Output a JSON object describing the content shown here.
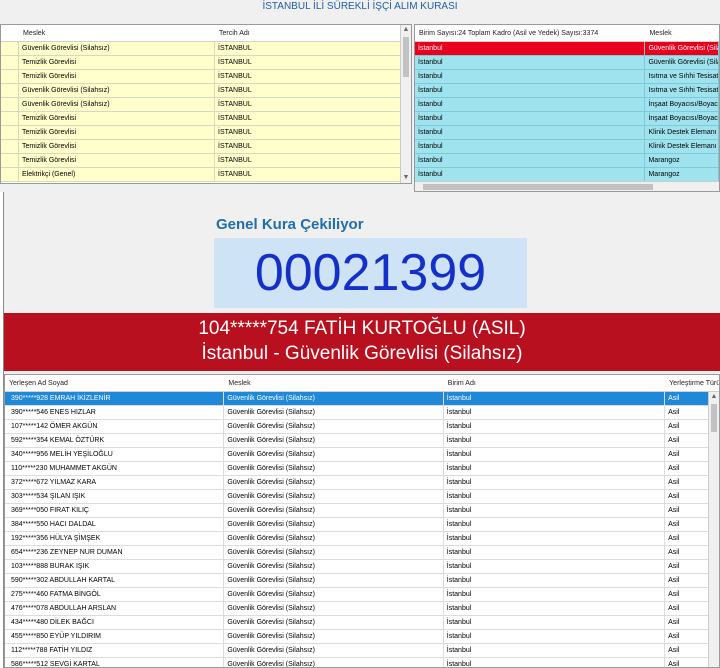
{
  "window": {
    "title": "İSTANBUL İLİ SÜREKLİ İŞÇİ ALIM KURASI"
  },
  "top_left": {
    "columns": [
      "Meslek",
      "Tercih Adı"
    ],
    "rows": [
      [
        "Güvenlik Görevlisi (Silahsız)",
        "İSTANBUL"
      ],
      [
        "Temizlik Görevlisi",
        "İSTANBUL"
      ],
      [
        "Temizlik Görevlisi",
        "İSTANBUL"
      ],
      [
        "Güvenlik Görevlisi (Silahsız)",
        "İSTANBUL"
      ],
      [
        "Güvenlik Görevlisi (Silahsız)",
        "İSTANBUL"
      ],
      [
        "Temizlik Görevlisi",
        "İSTANBUL"
      ],
      [
        "Temizlik Görevlisi",
        "İSTANBUL"
      ],
      [
        "Temizlik Görevlisi",
        "İSTANBUL"
      ],
      [
        "Temizlik Görevlisi",
        "İSTANBUL"
      ],
      [
        "Elektrikçi (Genel)",
        "İSTANBUL"
      ]
    ]
  },
  "top_right": {
    "columns": [
      "Birim Sayısı:24 Toplam Kadro (Asil ve Yedek) Sayısı:3374",
      "Meslek"
    ],
    "rows": [
      [
        "İstanbul",
        "Güvenlik Görevlisi (Silah"
      ],
      [
        "İstanbul",
        "Güvenlik Görevlisi (Silah"
      ],
      [
        "İstanbul",
        "Isıtma ve Sıhhi Tesisatçı"
      ],
      [
        "İstanbul",
        "Isıtma ve Sıhhi Tesisatçı"
      ],
      [
        "İstanbul",
        "İnşaat Boyacısı/Boyacı"
      ],
      [
        "İstanbul",
        "İnşaat Boyacısı/Boyacı"
      ],
      [
        "İstanbul",
        "Klinik Destek Elemanı (H"
      ],
      [
        "İstanbul",
        "Klinik Destek Elemanı (H"
      ],
      [
        "İstanbul",
        "Marangoz"
      ],
      [
        "İstanbul",
        "Marangoz"
      ]
    ]
  },
  "draw": {
    "label": "Genel Kura Çekiliyor",
    "number": "00021399",
    "winner_line1": "104*****754 FATİH KURTOĞLU (ASIL)",
    "winner_line2": "İstanbul - Güvenlik Görevlisi (Silahsız)"
  },
  "results": {
    "columns": [
      "Yerleşen Ad Soyad",
      "Meslek",
      "Birim Adı",
      "Yerleştirme Türü"
    ],
    "rows": [
      [
        "390*****928 EMRAH İKİZLENİR",
        "Güvenlik Görevlisi (Silahsız)",
        "İstanbul",
        "Asil"
      ],
      [
        "390*****546 ENES HIZLAR",
        "Güvenlik Görevlisi (Silahsız)",
        "İstanbul",
        "Asil"
      ],
      [
        "107*****142 ÖMER AKGÜN",
        "Güvenlik Görevlisi (Silahsız)",
        "İstanbul",
        "Asil"
      ],
      [
        "592*****354 KEMAL ÖZTÜRK",
        "Güvenlik Görevlisi (Silahsız)",
        "İstanbul",
        "Asil"
      ],
      [
        "340*****956 MELİH YEŞİLOĞLU",
        "Güvenlik Görevlisi (Silahsız)",
        "İstanbul",
        "Asil"
      ],
      [
        "110*****230 MUHAMMET AKGÜN",
        "Güvenlik Görevlisi (Silahsız)",
        "İstanbul",
        "Asil"
      ],
      [
        "372*****672 YILMAZ KARA",
        "Güvenlik Görevlisi (Silahsız)",
        "İstanbul",
        "Asil"
      ],
      [
        "303*****534 ŞILAN IŞIK",
        "Güvenlik Görevlisi (Silahsız)",
        "İstanbul",
        "Asil"
      ],
      [
        "369*****050 FIRAT KILIÇ",
        "Güvenlik Görevlisi (Silahsız)",
        "İstanbul",
        "Asil"
      ],
      [
        "384*****550 HACI DALDAL",
        "Güvenlik Görevlisi (Silahsız)",
        "İstanbul",
        "Asil"
      ],
      [
        "192*****356 HÜLYA ŞİMŞEK",
        "Güvenlik Görevlisi (Silahsız)",
        "İstanbul",
        "Asil"
      ],
      [
        "654*****236 ZEYNEP NUR DUMAN",
        "Güvenlik Görevlisi (Silahsız)",
        "İstanbul",
        "Asil"
      ],
      [
        "103*****888 BURAK IŞIK",
        "Güvenlik Görevlisi (Silahsız)",
        "İstanbul",
        "Asil"
      ],
      [
        "590*****302 ABDULLAH KARTAL",
        "Güvenlik Görevlisi (Silahsız)",
        "İstanbul",
        "Asil"
      ],
      [
        "275*****460 FATMA BİNGÖL",
        "Güvenlik Görevlisi (Silahsız)",
        "İstanbul",
        "Asil"
      ],
      [
        "476*****078 ABDULLAH ARSLAN",
        "Güvenlik Görevlisi (Silahsız)",
        "İstanbul",
        "Asil"
      ],
      [
        "434*****480 DİLEK BAĞCI",
        "Güvenlik Görevlisi (Silahsız)",
        "İstanbul",
        "Asil"
      ],
      [
        "455*****850 EYÜP YILDIRIM",
        "Güvenlik Görevlisi (Silahsız)",
        "İstanbul",
        "Asil"
      ],
      [
        "112*****788 FATİH YILDIZ",
        "Güvenlik Görevlisi (Silahsız)",
        "İstanbul",
        "Asil"
      ],
      [
        "586*****512 SEVGİ KARTAL",
        "Güvenlik Görevlisi (Silahsız)",
        "İstanbul",
        "Asil"
      ]
    ]
  },
  "colors": {
    "left_row_bg": "#ffffcc",
    "right_row_bg": "#9fe3ee",
    "selected_red": "#e8001c",
    "selected_blue": "#1f88d8",
    "banner_red": "#b8101e",
    "number_blue": "#1430c8"
  }
}
